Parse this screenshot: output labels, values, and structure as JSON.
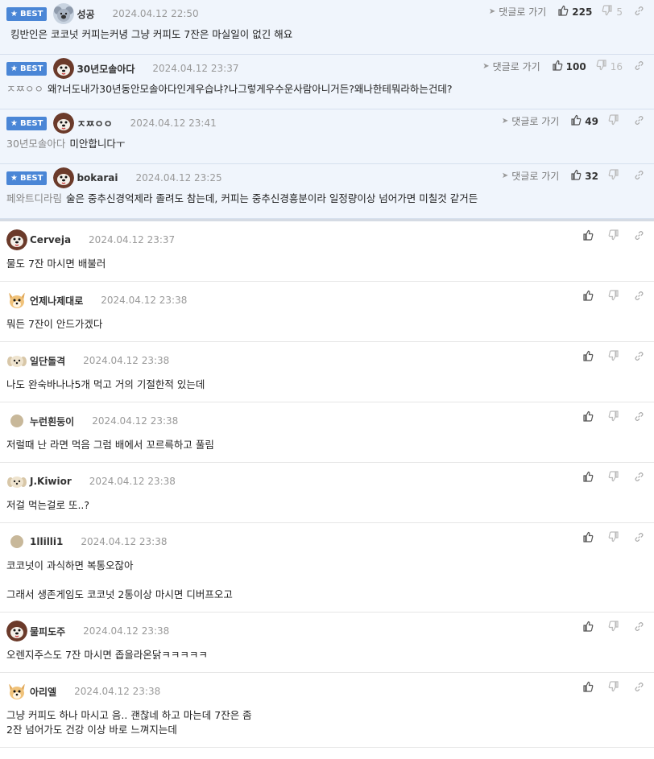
{
  "best_label": "BEST",
  "reply_label": "댓글로 가기",
  "best_comments": [
    {
      "nick": "성공",
      "date": "2024.04.12 22:50",
      "likes": "225",
      "dislikes": "5",
      "mention": "",
      "text": "킹반인은 코코넛 커피는커녕 그냥 커피도 7잔은 마실일이 없긴 해요",
      "avatar": "koala"
    },
    {
      "nick": "30년모솔아다",
      "date": "2024.04.12 23:37",
      "likes": "100",
      "dislikes": "16",
      "mention": "ㅈㅉㅇㅇ",
      "text": "왜?너도내가30년동안모솔아다인게우습냐?나그렇게우수운사람아니거든?왜나한테뭐라하는건데?",
      "avatar": "dog"
    },
    {
      "nick": "ㅈㅉㅇㅇ",
      "date": "2024.04.12 23:41",
      "likes": "49",
      "dislikes": "",
      "mention": "30년모솔아다",
      "text": "미안합니다ㅜ",
      "avatar": "dog"
    },
    {
      "nick": "bokarai",
      "date": "2024.04.12 23:25",
      "likes": "32",
      "dislikes": "",
      "mention": "페와트디라림",
      "text": "술은 중추신경억제라 졸려도 참는데, 커피는 중추신경흥분이라 일정량이상 넘어가면 미칠것 같거든",
      "avatar": "dog"
    }
  ],
  "comments": [
    {
      "nick": "Cerveja",
      "date": "2024.04.12 23:37",
      "text": "물도 7잔 마시면 배불러",
      "avatar": "dog"
    },
    {
      "nick": "언제나제대로",
      "date": "2024.04.12 23:38",
      "text": "뭐든 7잔이 안드가겠다",
      "avatar": "fox"
    },
    {
      "nick": "일단돌격",
      "date": "2024.04.12 23:38",
      "text": "나도 완숙바나나5개 먹고 거의 기절한적 있는데",
      "avatar": "puppy"
    },
    {
      "nick": "누런흰둥이",
      "date": "2024.04.12 23:38",
      "text": "저럴때 난 라면 먹음 그럼 배에서 꼬르륵하고 풀림",
      "avatar": "circle"
    },
    {
      "nick": "J.Kiwior",
      "date": "2024.04.12 23:38",
      "text": "저걸 먹는걸로 또..?",
      "avatar": "puppy"
    },
    {
      "nick": "1llilli1",
      "date": "2024.04.12 23:38",
      "text": "코코넛이 과식하면 복통오잖아\n\n그래서 생존게임도 코코넛 2통이상 마시면 디버프오고",
      "avatar": "circle"
    },
    {
      "nick": "물피도주",
      "date": "2024.04.12 23:38",
      "text": "오렌지주스도 7잔 마시면 좁을라온닭ㅋㅋㅋㅋㅋ",
      "avatar": "dog"
    },
    {
      "nick": "아리엘",
      "date": "2024.04.12 23:38",
      "text": "그냥 커피도 하나 마시고 음.. 괜찮네 하고 마는데 7잔은 좀\n2잔 넘어가도 건강 이상 바로 느껴지는데",
      "avatar": "fox"
    }
  ]
}
